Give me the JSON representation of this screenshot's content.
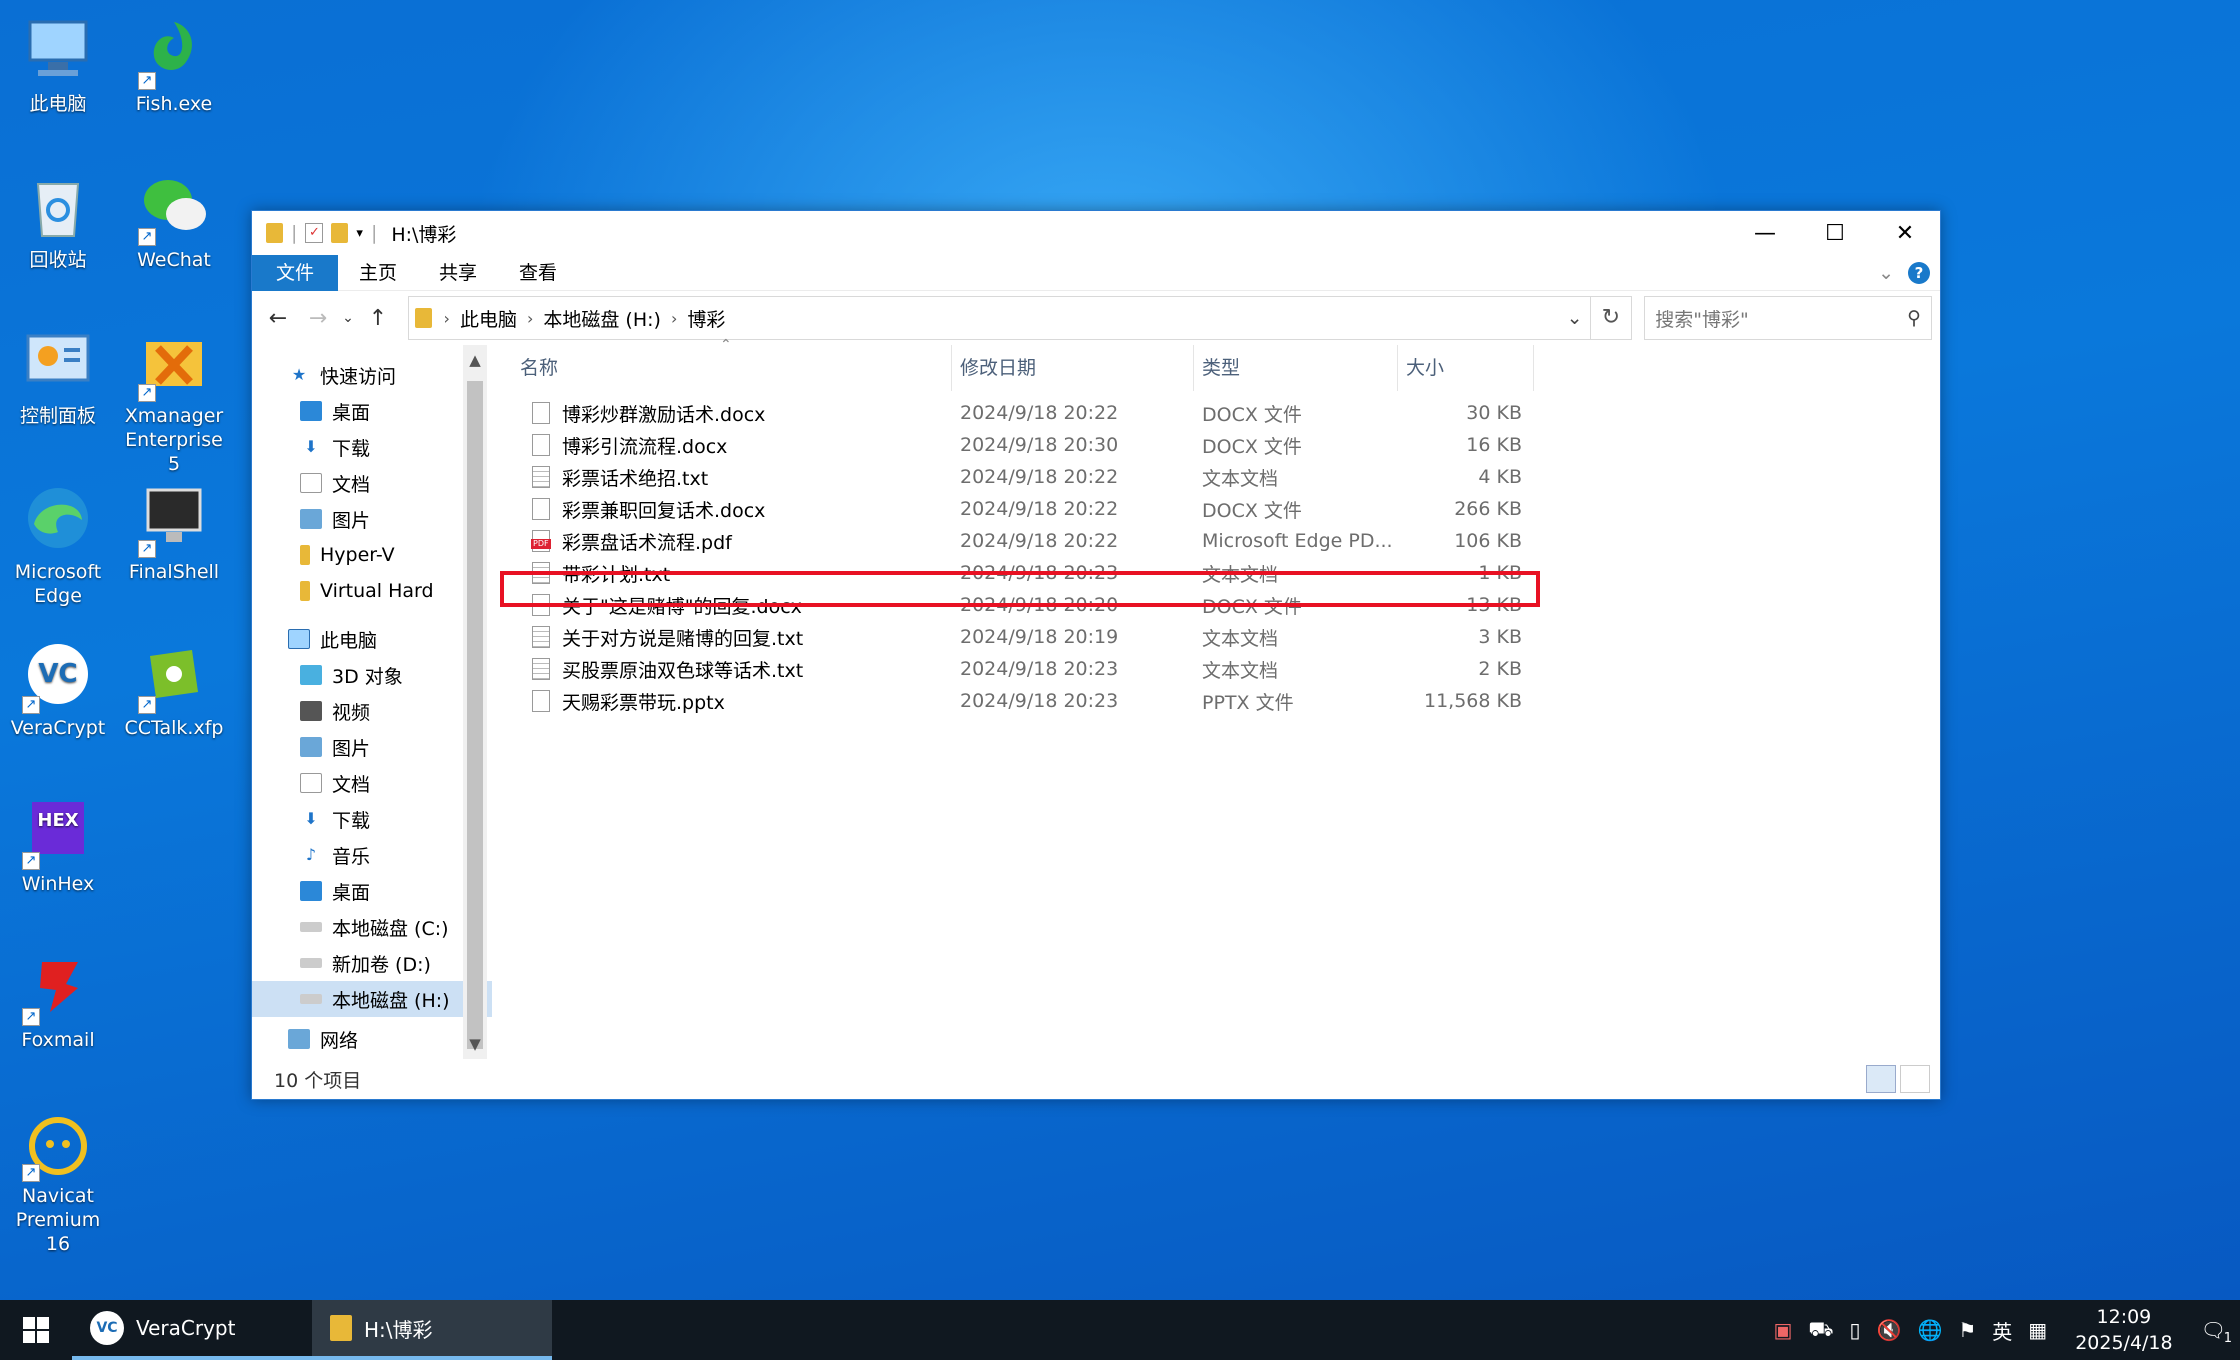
{
  "desktop": {
    "icons": [
      {
        "label": "此电脑",
        "icon": "this-pc-icon"
      },
      {
        "label": "Fish.exe",
        "icon": "fish-exe-icon"
      },
      {
        "label": "回收站",
        "icon": "recycle-bin-icon"
      },
      {
        "label": "WeChat",
        "icon": "wechat-icon"
      },
      {
        "label": "控制面板",
        "icon": "control-panel-icon"
      },
      {
        "label": "Xmanager Enterprise 5",
        "icon": "xmanager-icon"
      },
      {
        "label": "Microsoft Edge",
        "icon": "edge-icon"
      },
      {
        "label": "FinalShell",
        "icon": "finalshell-icon"
      },
      {
        "label": "VeraCrypt",
        "icon": "veracrypt-icon"
      },
      {
        "label": "CCTalk.xfp",
        "icon": "cctalk-icon"
      },
      {
        "label": "WinHex",
        "icon": "winhex-icon"
      },
      {
        "label": "Foxmail",
        "icon": "foxmail-icon"
      },
      {
        "label": "Navicat Premium 16",
        "icon": "navicat-icon"
      }
    ]
  },
  "explorer": {
    "title": "H:\\博彩",
    "ribbon": {
      "file": "文件",
      "home": "主页",
      "share": "共享",
      "view": "查看"
    },
    "path": [
      "此电脑",
      "本地磁盘 (H:)",
      "博彩"
    ],
    "search_placeholder": "搜索\"博彩\"",
    "sidebar": {
      "quick_access": "快速访问",
      "quick_items": [
        "桌面",
        "下载",
        "文档",
        "图片",
        "Hyper-V",
        "Virtual Hard"
      ],
      "this_pc": "此电脑",
      "pc_items": [
        "3D 对象",
        "视频",
        "图片",
        "文档",
        "下载",
        "音乐",
        "桌面",
        "本地磁盘 (C:)",
        "新加卷 (D:)",
        "本地磁盘 (H:)"
      ],
      "network": "网络"
    },
    "columns": {
      "name": "名称",
      "date": "修改日期",
      "type": "类型",
      "size": "大小"
    },
    "files": [
      {
        "name": "博彩炒群激励话术.docx",
        "date": "2024/9/18 20:22",
        "type": "DOCX 文件",
        "size": "30 KB",
        "kind": "doc"
      },
      {
        "name": "博彩引流流程.docx",
        "date": "2024/9/18 20:30",
        "type": "DOCX 文件",
        "size": "16 KB",
        "kind": "doc"
      },
      {
        "name": "彩票话术绝招.txt",
        "date": "2024/9/18 20:22",
        "type": "文本文档",
        "size": "4 KB",
        "kind": "txt"
      },
      {
        "name": "彩票兼职回复话术.docx",
        "date": "2024/9/18 20:22",
        "type": "DOCX 文件",
        "size": "266 KB",
        "kind": "doc"
      },
      {
        "name": "彩票盘话术流程.pdf",
        "date": "2024/9/18 20:22",
        "type": "Microsoft Edge PD...",
        "size": "106 KB",
        "kind": "pdf"
      },
      {
        "name": "带彩计划.txt",
        "date": "2024/9/18 20:23",
        "type": "文本文档",
        "size": "1 KB",
        "kind": "txt"
      },
      {
        "name": "关于\"这是赌博\"的回复.docx",
        "date": "2024/9/18 20:20",
        "type": "DOCX 文件",
        "size": "13 KB",
        "kind": "doc"
      },
      {
        "name": "关于对方说是赌博的回复.txt",
        "date": "2024/9/18 20:19",
        "type": "文本文档",
        "size": "3 KB",
        "kind": "txt"
      },
      {
        "name": "买股票原油双色球等话术.txt",
        "date": "2024/9/18 20:23",
        "type": "文本文档",
        "size": "2 KB",
        "kind": "txt"
      },
      {
        "name": "天赐彩票带玩.pptx",
        "date": "2024/9/18 20:23",
        "type": "PPTX 文件",
        "size": "11,568 KB",
        "kind": "doc"
      }
    ],
    "highlighted_file": "带彩计划.txt",
    "status": "10 个项目"
  },
  "taskbar": {
    "apps": [
      {
        "label": "VeraCrypt"
      },
      {
        "label": "H:\\博彩"
      }
    ],
    "ime": "英",
    "time": "12:09",
    "date": "2025/4/18",
    "notifications": "1"
  }
}
